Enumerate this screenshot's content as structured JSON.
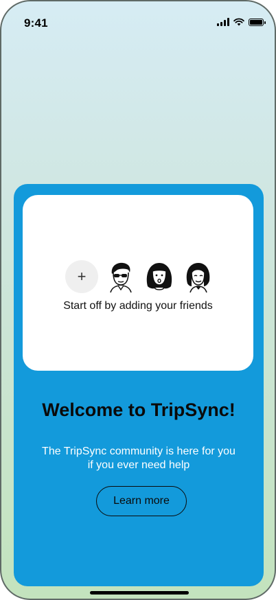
{
  "status_bar": {
    "time": "9:41",
    "icons": [
      "cellular-signal-icon",
      "wifi-icon",
      "battery-icon"
    ]
  },
  "friends": {
    "add_button_label": "+",
    "avatars": [
      "avatar-man-sunglasses",
      "avatar-woman-surprised",
      "avatar-woman-smiling"
    ],
    "caption": "Start off by adding your friends"
  },
  "welcome": {
    "title": "Welcome to TripSync!",
    "subtitle": "The TripSync community is here for you if you ever need help",
    "learn_more_label": "Learn more"
  },
  "colors": {
    "card": "#139adb",
    "inner_card": "#ffffff",
    "text_dark": "#0a0a0a",
    "text_light": "#ffffff"
  }
}
